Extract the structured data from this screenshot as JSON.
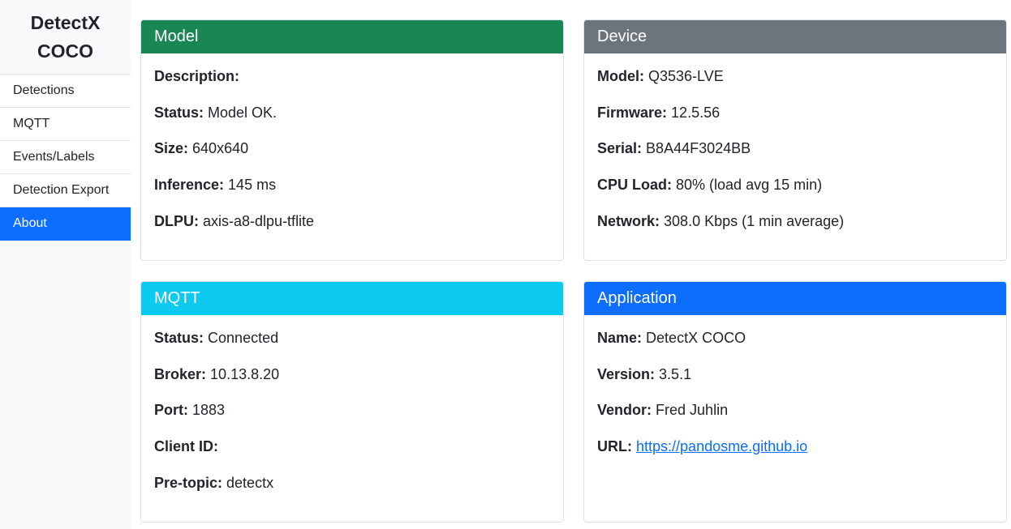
{
  "sidebar": {
    "brand_line1": "DetectX",
    "brand_line2": "COCO",
    "items": [
      {
        "label": "Detections"
      },
      {
        "label": "MQTT"
      },
      {
        "label": "Events/Labels"
      },
      {
        "label": "Detection Export"
      },
      {
        "label": "About",
        "active": true
      }
    ]
  },
  "colors": {
    "model_header": "#198754",
    "device_header": "#6c757d",
    "mqtt_header": "#0dcaf0",
    "application_header": "#0d6efd",
    "active_nav": "#0d6efd"
  },
  "model": {
    "title": "Model",
    "rows": [
      {
        "label": "Description:",
        "value": ""
      },
      {
        "label": "Status:",
        "value": "Model OK."
      },
      {
        "label": "Size:",
        "value": "640x640"
      },
      {
        "label": "Inference:",
        "value": "145 ms"
      },
      {
        "label": "DLPU:",
        "value": "axis-a8-dlpu-tflite"
      }
    ]
  },
  "device": {
    "title": "Device",
    "rows": [
      {
        "label": "Model:",
        "value": "Q3536-LVE"
      },
      {
        "label": "Firmware:",
        "value": "12.5.56"
      },
      {
        "label": "Serial:",
        "value": "B8A44F3024BB"
      },
      {
        "label": "CPU Load:",
        "value": "80% (load avg 15 min)"
      },
      {
        "label": "Network:",
        "value": "308.0 Kbps (1 min average)"
      }
    ]
  },
  "mqtt": {
    "title": "MQTT",
    "rows": [
      {
        "label": "Status:",
        "value": "Connected"
      },
      {
        "label": "Broker:",
        "value": "10.13.8.20"
      },
      {
        "label": "Port:",
        "value": "1883"
      },
      {
        "label": "Client ID:",
        "value": ""
      },
      {
        "label": "Pre-topic:",
        "value": "detectx"
      }
    ]
  },
  "application": {
    "title": "Application",
    "rows": [
      {
        "label": "Name:",
        "value": "DetectX COCO"
      },
      {
        "label": "Version:",
        "value": "3.5.1"
      },
      {
        "label": "Vendor:",
        "value": "Fred Juhlin"
      },
      {
        "label": "URL:",
        "value": "https://pandosme.github.io"
      }
    ]
  }
}
